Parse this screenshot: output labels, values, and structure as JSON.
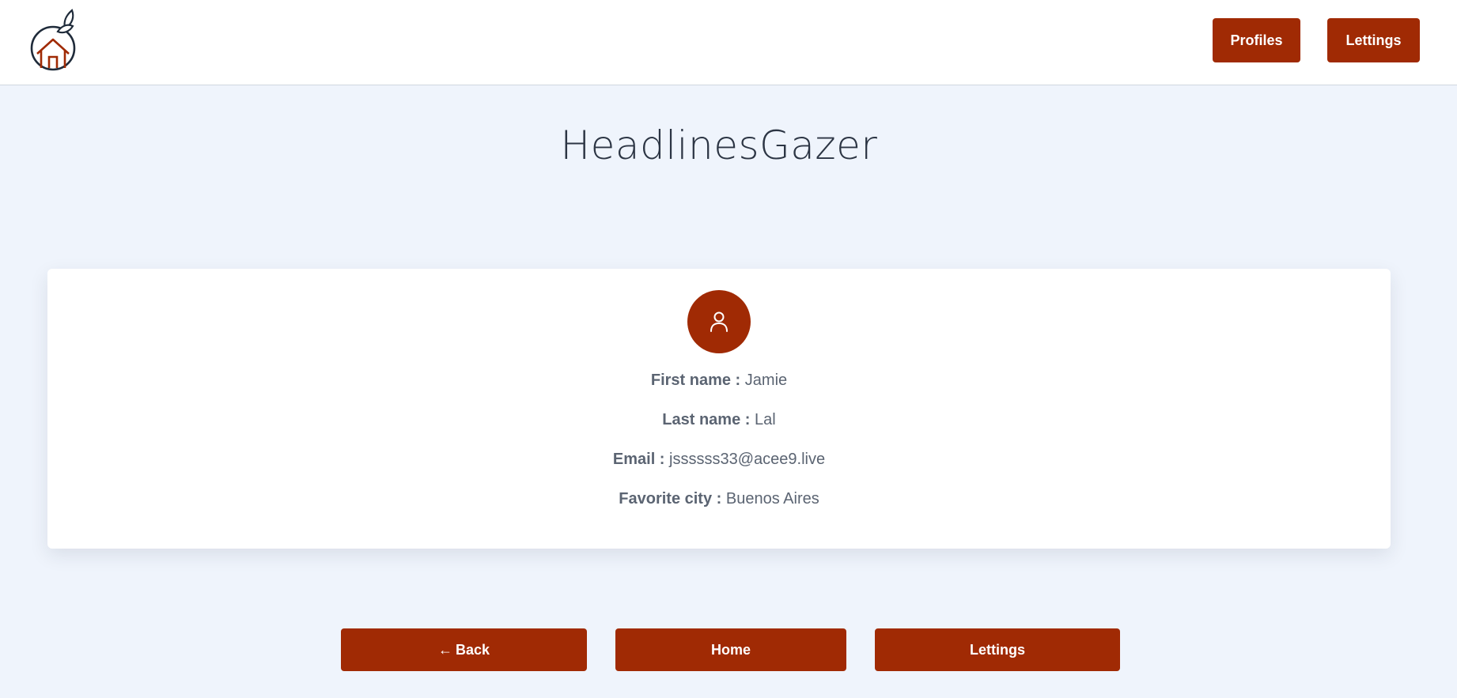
{
  "header": {
    "logo_icon": "orange-house-logo",
    "nav": {
      "profiles_label": "Profiles",
      "lettings_label": "Lettings"
    }
  },
  "page": {
    "title": "HeadlinesGazer"
  },
  "profile": {
    "avatar_icon": "user-icon",
    "first_name_label": "First name :",
    "first_name": "Jamie",
    "last_name_label": "Last name :",
    "last_name": "Lal",
    "email_label": "Email :",
    "email": "jssssss33@acee9.live",
    "city_label": "Favorite city :",
    "city": "Buenos Aires"
  },
  "actions": {
    "back_arrow": "←",
    "back_label": "Back",
    "home_label": "Home",
    "lettings_label": "Lettings"
  },
  "colors": {
    "accent": "#a02a04",
    "background": "#eff4fc",
    "title": "#2c3544",
    "text": "#5b6472"
  }
}
